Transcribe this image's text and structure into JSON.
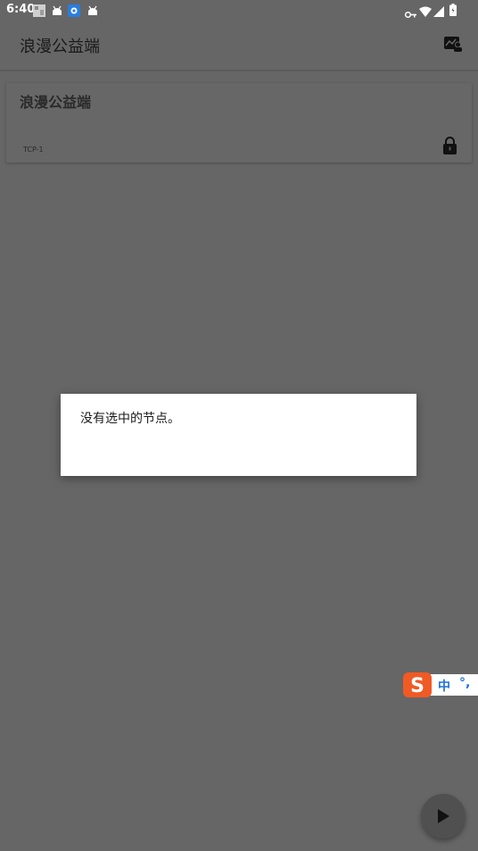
{
  "status_bar": {
    "time": "6:40",
    "notification_icons": [
      "gallery-icon",
      "android-icon",
      "app-icon",
      "android-icon"
    ],
    "right_icons": [
      "vpn-key-icon",
      "wifi-icon",
      "signal-icon",
      "battery-icon"
    ]
  },
  "app_bar": {
    "title": "浪漫公益端",
    "action_icon": "speed-test-icon"
  },
  "server_card": {
    "name": "浪漫公益端",
    "protocol": "TCP-1",
    "lock_icon": "lock-icon"
  },
  "dialog": {
    "message": "没有选中的节点。"
  },
  "ime_bar": {
    "logo": "S",
    "mode": "中",
    "punct": "°,"
  },
  "fab": {
    "icon": "play-icon"
  },
  "colors": {
    "scrim_background": "#666666",
    "dialog_background": "#ffffff",
    "ime_orange": "#f05a24",
    "ime_blue": "#1e6fd9"
  }
}
